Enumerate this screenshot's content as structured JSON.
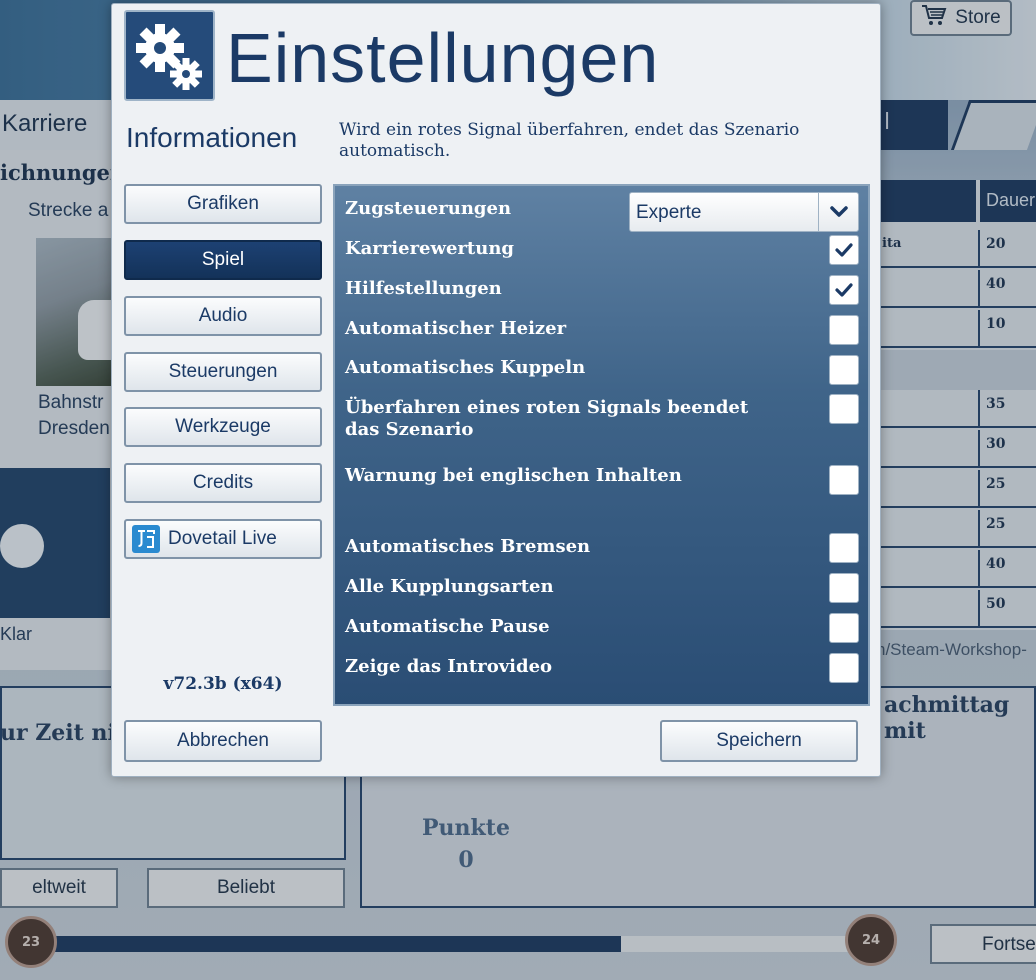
{
  "background": {
    "store_label": "Store",
    "tab_karriere": "Karriere",
    "tab_right_fragment": "l",
    "aufzeichnungen_fragment": "ichnungen",
    "strecke_fragment": "Strecke a",
    "route_line1": "Bahnstr",
    "route_line2": "Dresden",
    "weather_label": "Klar",
    "zeit_fragment": "ur Zeit nicl",
    "btn_weltweit": "eltweit",
    "btn_beliebt": "Beliebt",
    "punkte_label": "Punkte",
    "punkte_value": "0",
    "nachmittag_fragment": "achmittag mit",
    "table_header": "Dauer",
    "table_rows": [
      {
        "name": "ita",
        "value": "20"
      },
      {
        "name": "",
        "value": "40"
      },
      {
        "name": "",
        "value": "10"
      },
      {
        "name": "",
        "value": "35"
      },
      {
        "name": "",
        "value": "30"
      },
      {
        "name": "",
        "value": "25"
      },
      {
        "name": "",
        "value": "25"
      },
      {
        "name": "",
        "value": "40"
      },
      {
        "name": "",
        "value": "50"
      }
    ],
    "path_fragment": "n/Steam-Workshop-",
    "fortsetzen_fragment": "Fortse",
    "level_current": "23",
    "level_next": "24",
    "level_progress": 0.7
  },
  "dialog": {
    "title": "Einstellungen",
    "info_heading": "Informationen",
    "info_text": "Wird ein rotes Signal überfahren, endet das Szenario automatisch.",
    "nav": [
      {
        "label": "Grafiken",
        "active": false
      },
      {
        "label": "Spiel",
        "active": true
      },
      {
        "label": "Audio",
        "active": false
      },
      {
        "label": "Steuerungen",
        "active": false
      },
      {
        "label": "Werkzeuge",
        "active": false
      },
      {
        "label": "Credits",
        "active": false
      },
      {
        "label": "Dovetail Live",
        "active": false
      }
    ],
    "version": "v72.3b (x64)",
    "settings": {
      "zugsteuerungen_label": "Zugsteuerungen",
      "zugsteuerungen_value": "Experte",
      "items": [
        {
          "label": "Karrierewertung",
          "checked": true
        },
        {
          "label": "Hilfestellungen",
          "checked": true
        },
        {
          "label": "Automatischer Heizer",
          "checked": false
        },
        {
          "label": "Automatisches Kuppeln",
          "checked": false
        },
        {
          "label": "Überfahren eines roten Signals beendet das Szenario",
          "checked": false
        },
        {
          "label": "Warnung bei englischen Inhalten",
          "checked": false
        },
        {
          "label": "Automatisches Bremsen",
          "checked": false
        },
        {
          "label": "Alle Kupplungsarten",
          "checked": false
        },
        {
          "label": "Automatische Pause",
          "checked": false
        },
        {
          "label": "Zeige das Introvideo",
          "checked": false
        }
      ]
    },
    "cancel_label": "Abbrechen",
    "save_label": "Speichern"
  },
  "colors": {
    "primary_navy": "#1b3a66",
    "active_nav": "#133259",
    "panel_top": "#5f81a3",
    "panel_bottom": "#2a4d74"
  }
}
